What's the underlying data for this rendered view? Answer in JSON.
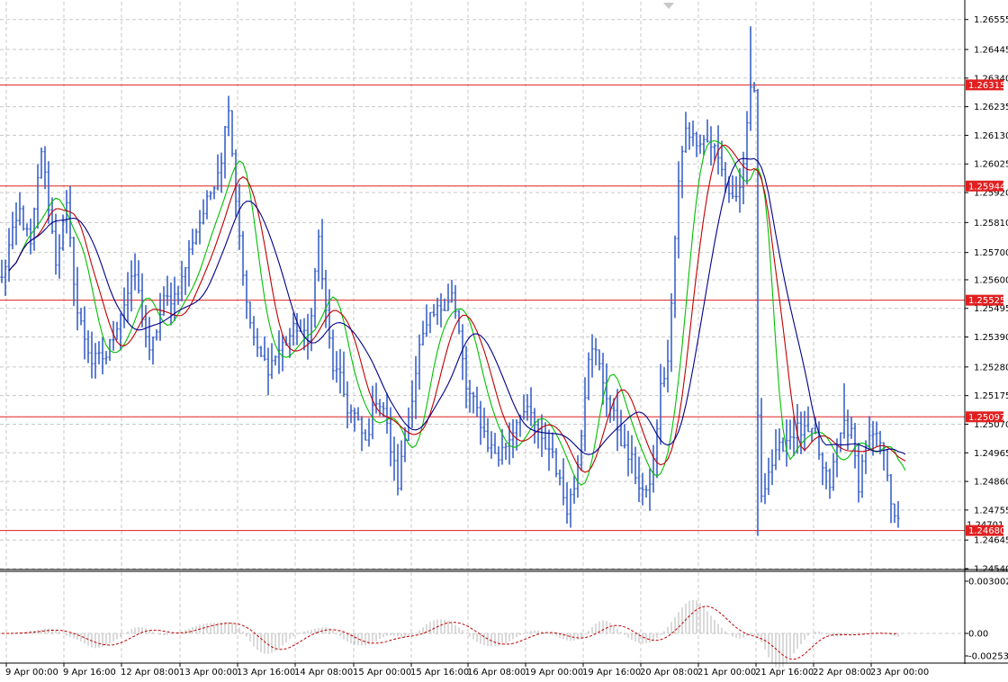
{
  "chart_data": {
    "type": "line",
    "chart_style": "bar-ohlc",
    "colors": {
      "background": "#ffffff",
      "grid": "#c8c8c8",
      "price": "#3a62c8",
      "ma_fast": "#00c000",
      "ma_mid": "#c00000",
      "ma_slow": "#00008b",
      "level": "#e02020",
      "osc_bar": "#b4b4b4",
      "osc_signal": "#c00000"
    },
    "grid": true,
    "ylim": [
      1.2454,
      1.2662
    ],
    "price_ticks": [
      "1.26555",
      "1.26445",
      "1.26340",
      "1.26235",
      "1.26130",
      "1.26025",
      "1.25920",
      "1.25810",
      "1.25700",
      "1.25600",
      "1.25495",
      "1.25390",
      "1.25280",
      "1.25175",
      "1.25070",
      "1.24965",
      "1.24860",
      "1.24755",
      "1.24645",
      "1.24540"
    ],
    "horizontal_levels": [
      "1.26315",
      "1.25944",
      "1.25525",
      "1.25097",
      "1.24680"
    ],
    "current_price_label": "1.24701",
    "x_labels": [
      "9 Apr 00:00",
      "9 Apr 16:00",
      "12 Apr 08:00",
      "13 Apr 00:00",
      "13 Apr 16:00",
      "14 Apr 08:00",
      "15 Apr 00:00",
      "15 Apr 16:00",
      "16 Apr 08:00",
      "19 Apr 00:00",
      "19 Apr 16:00",
      "20 Apr 08:00",
      "21 Apr 00:00",
      "21 Apr 16:00",
      "22 Apr 08:00",
      "23 Apr 00:00"
    ],
    "price_keypoints": [
      [
        0,
        1.256
      ],
      [
        2,
        1.2572
      ],
      [
        5,
        1.2585
      ],
      [
        8,
        1.2572
      ],
      [
        11,
        1.2608
      ],
      [
        15,
        1.2567
      ],
      [
        18,
        1.2586
      ],
      [
        21,
        1.2548
      ],
      [
        25,
        1.253
      ],
      [
        29,
        1.2532
      ],
      [
        33,
        1.2548
      ],
      [
        37,
        1.2562
      ],
      [
        41,
        1.2532
      ],
      [
        45,
        1.2552
      ],
      [
        49,
        1.2555
      ],
      [
        53,
        1.2575
      ],
      [
        57,
        1.2588
      ],
      [
        61,
        1.2605
      ],
      [
        63,
        1.2625
      ],
      [
        65,
        1.259
      ],
      [
        68,
        1.255
      ],
      [
        71,
        1.2533
      ],
      [
        74,
        1.2528
      ],
      [
        78,
        1.2536
      ],
      [
        82,
        1.2543
      ],
      [
        85,
        1.2537
      ],
      [
        88,
        1.2575
      ],
      [
        90,
        1.2547
      ],
      [
        92,
        1.2528
      ],
      [
        94,
        1.2523
      ],
      [
        96,
        1.2513
      ],
      [
        98,
        1.251
      ],
      [
        101,
        1.25
      ],
      [
        104,
        1.2517
      ],
      [
        106,
        1.2513
      ],
      [
        108,
        1.2498
      ],
      [
        110,
        1.2485
      ],
      [
        113,
        1.251
      ],
      [
        116,
        1.2535
      ],
      [
        119,
        1.2545
      ],
      [
        122,
        1.255
      ],
      [
        125,
        1.2555
      ],
      [
        127,
        1.254
      ],
      [
        129,
        1.252
      ],
      [
        132,
        1.2512
      ],
      [
        135,
        1.25
      ],
      [
        138,
        1.2495
      ],
      [
        141,
        1.2502
      ],
      [
        144,
        1.2512
      ],
      [
        147,
        1.251
      ],
      [
        150,
        1.25
      ],
      [
        153,
        1.2497
      ],
      [
        155,
        1.2485
      ],
      [
        157,
        1.2477
      ],
      [
        159,
        1.2484
      ],
      [
        161,
        1.2505
      ],
      [
        163,
        1.2533
      ],
      [
        165,
        1.2533
      ],
      [
        167,
        1.2523
      ],
      [
        169,
        1.2513
      ],
      [
        171,
        1.2506
      ],
      [
        173,
        1.2497
      ],
      [
        175,
        1.2493
      ],
      [
        177,
        1.2485
      ],
      [
        179,
        1.248
      ],
      [
        181,
        1.2493
      ],
      [
        183,
        1.252
      ],
      [
        185,
        1.253
      ],
      [
        186,
        1.255
      ],
      [
        187,
        1.2575
      ],
      [
        188,
        1.2595
      ],
      [
        190,
        1.2617
      ],
      [
        192,
        1.2612
      ],
      [
        194,
        1.2612
      ],
      [
        196,
        1.2611
      ],
      [
        198,
        1.2608
      ],
      [
        200,
        1.26
      ],
      [
        202,
        1.2592
      ],
      [
        204,
        1.259
      ],
      [
        206,
        1.26
      ],
      [
        208,
        1.263
      ],
      [
        209,
        1.263
      ],
      [
        210,
        1.2508
      ],
      [
        211,
        1.2482
      ],
      [
        213,
        1.249
      ],
      [
        215,
        1.2495
      ],
      [
        217,
        1.25
      ],
      [
        219,
        1.2503
      ],
      [
        221,
        1.2505
      ],
      [
        224,
        1.2503
      ],
      [
        226,
        1.2502
      ],
      [
        228,
        1.249
      ],
      [
        230,
        1.2485
      ],
      [
        232,
        1.2498
      ],
      [
        234,
        1.2508
      ],
      [
        236,
        1.2503
      ],
      [
        238,
        1.2485
      ],
      [
        240,
        1.25
      ],
      [
        242,
        1.2502
      ],
      [
        244,
        1.25
      ],
      [
        245,
        1.2495
      ],
      [
        246,
        1.249
      ],
      [
        247,
        1.248
      ],
      [
        248,
        1.2475
      ],
      [
        249,
        1.247
      ]
    ]
  }
}
